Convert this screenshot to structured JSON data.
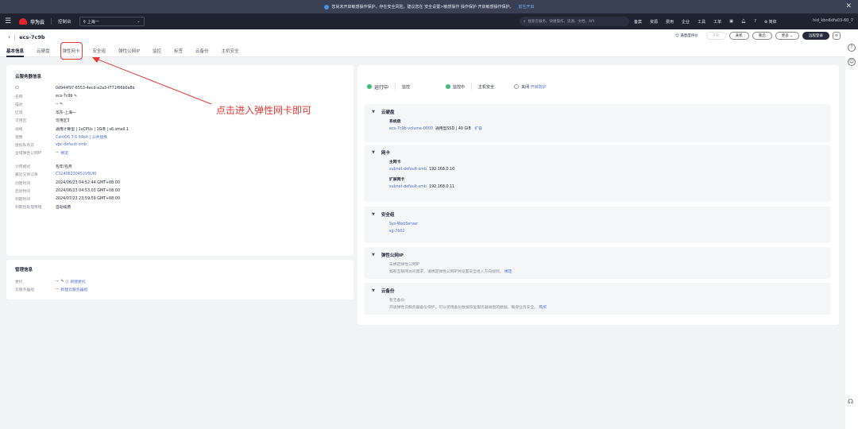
{
  "notice": {
    "text": "您尚未开启敏感操作保护，存在安全风险，建议您在 安全设置>敏感操作 操作保护 开启敏感操作保护。",
    "link": "前往开启",
    "close": "✕"
  },
  "topnav": {
    "menu": "☰",
    "brand": "华为云",
    "console": "控制台",
    "region": "上海一",
    "search_placeholder": "搜索云服务、快捷操作、资源、文档、API",
    "links": [
      "备案",
      "资源",
      "费用",
      "企业",
      "工具",
      "工单"
    ],
    "lang": "简体",
    "account": "hid_kbn6dfa03-60_7"
  },
  "titlebar": {
    "back": "‹",
    "name": "ecs-7c9b",
    "feedback": "满意度评价",
    "buttons": {
      "start": "开机",
      "stop": "关机",
      "restart": "重启",
      "more": "更多",
      "remote": "远程登录"
    }
  },
  "tabs": [
    "基本信息",
    "云硬盘",
    "弹性网卡",
    "安全组",
    "弹性公网IP",
    "监控",
    "标签",
    "云备份",
    "主机安全"
  ],
  "info": {
    "title": "云服务器信息",
    "rows": [
      {
        "k": "ID",
        "v": "0d944f97-6553-4ecd-a2a3-f771f66b0a8b"
      },
      {
        "k": "名称",
        "v": "ecs-7c9b"
      },
      {
        "k": "描述",
        "v": "--"
      },
      {
        "k": "区域",
        "v": "华东-上海一"
      },
      {
        "k": "可用区",
        "v": "可用区3"
      },
      {
        "k": "规格",
        "v": "通用计算型 | 1vCPUs | 1GiB | s6.small.1"
      },
      {
        "k": "镜像",
        "v": "CentOS 7.6 64bit | 公共镜像"
      },
      {
        "k": "虚拟私有云",
        "v": "vpc-default-smb"
      },
      {
        "k": "全域弹性公网IP",
        "v": "--",
        "link": "绑定"
      }
    ],
    "billing_rows": [
      {
        "k": "计费模式",
        "v": "包年/包月"
      },
      {
        "k": "最近交易订单",
        "v": "CS2406230452V6UKI"
      },
      {
        "k": "创建时间",
        "v": "2024/06/23 04:52:44 GMT+08:00"
      },
      {
        "k": "启动时间",
        "v": "2024/06/23 04:53:03 GMT+08:00"
      },
      {
        "k": "到期时间",
        "v": "2024/07/23 23:59:59 GMT+08:00"
      },
      {
        "k": "到期后处理策略",
        "v": "自动续费"
      }
    ]
  },
  "mgmt": {
    "title": "管理信息",
    "rows": [
      {
        "k": "委托",
        "v": "--",
        "link": "新建委托"
      },
      {
        "k": "云服务器组",
        "v": "--",
        "link": "新建云服务器组"
      }
    ]
  },
  "status": {
    "running": "运行中",
    "monitor": "监控",
    "monitoring": "监控中",
    "host_security": "主机安全",
    "off": "关闭",
    "enable": "开启防护"
  },
  "panels": {
    "disk": {
      "title": "云硬盘",
      "sys": "系统盘",
      "vol": "ecs-7c9b-volume-0000",
      "detail": "通用型SSD | 40 GiB",
      "expand": "扩容"
    },
    "nic": {
      "title": "网卡",
      "primary": "主网卡",
      "p_subnet": "subnet-default-smb",
      "p_ip": "192.168.0.10",
      "ext": "扩展网卡",
      "e_subnet": "subnet-default-smb",
      "e_ip": "192.168.0.11"
    },
    "sg": {
      "title": "安全组",
      "items": [
        "Sys-WebServer",
        "sg-7b02"
      ]
    },
    "eip": {
      "title": "弹性公网IP",
      "none": "未绑定弹性公网IP",
      "desc": "如有互联网访问需求，请绑定弹性公网IP并设置安全组入方向规则。",
      "link": "绑定"
    },
    "backup": {
      "title": "云备份",
      "none": "暂无备份",
      "desc": "开通弹性云服务器备份保护，可以使用备份数据恢复服务器磁盘的数据，确保业务安全。",
      "link": "购买"
    }
  },
  "annotation": "点击进入弹性网卡即可",
  "colors": {
    "annotation": "#e53935",
    "link": "#526ecc",
    "nav_bg": "#1f2330"
  }
}
